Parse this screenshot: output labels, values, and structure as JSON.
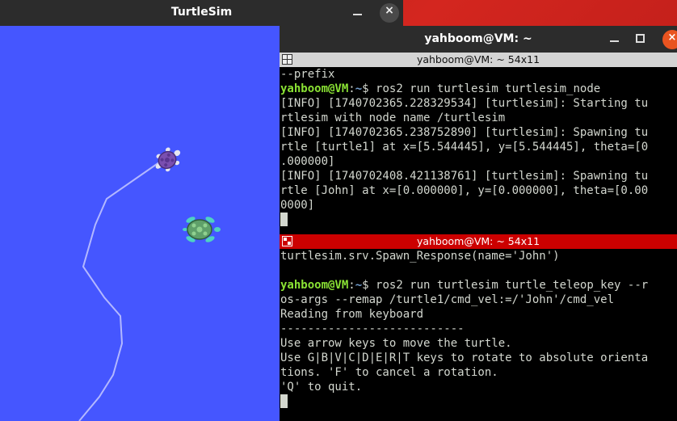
{
  "turtlesim": {
    "title": "TurtleSim",
    "minimize_icon": "minimize-icon",
    "close_glyph": "×",
    "background_color": "#4556ff",
    "trail_color": "#b3b8ff",
    "turtles": [
      {
        "name": "turtle1",
        "shell_color": "#7a4fb0",
        "icon": "turtle-icon"
      },
      {
        "name": "John",
        "shell_color": "#5fa06a",
        "icon": "turtle-icon"
      }
    ]
  },
  "terminal": {
    "title": "yahboom@VM: ~",
    "close_glyph": "×",
    "pane1": {
      "label": "yahboom@VM: ~ 54x11",
      "lines": [
        "--prefix",
        {
          "user": "yahboom@VM",
          "path": "~",
          "cmd": "$ ros2 run turtlesim turtlesim_node"
        },
        "[INFO] [1740702365.228329534] [turtlesim]: Starting tu",
        "rtlesim with node name /turtlesim",
        "[INFO] [1740702365.238752890] [turtlesim]: Spawning tu",
        "rtle [turtle1] at x=[5.544445], y=[5.544445], theta=[0",
        ".000000]",
        "[INFO] [1740702408.421138761] [turtlesim]: Spawning tu",
        "rtle [John] at x=[0.000000], y=[0.000000], theta=[0.00",
        "0000]"
      ]
    },
    "pane2": {
      "label": "yahboom@VM: ~ 54x11",
      "lines": [
        "turtlesim.srv.Spawn_Response(name='John')",
        "",
        {
          "user": "yahboom@VM",
          "path": "~",
          "cmd": "$ ros2 run turtlesim turtle_teleop_key --r"
        },
        "os-args --remap /turtle1/cmd_vel:=/'John'/cmd_vel",
        "Reading from keyboard",
        "---------------------------",
        "Use arrow keys to move the turtle.",
        "Use G|B|V|C|D|E|R|T keys to rotate to absolute orienta",
        "tions. 'F' to cancel a rotation.",
        "'Q' to quit."
      ]
    },
    "colors": {
      "user": "#8ae234",
      "path": "#729fcf",
      "active_pane_bar": "#cc0000",
      "inactive_pane_bar": "#d4d4d4"
    }
  }
}
